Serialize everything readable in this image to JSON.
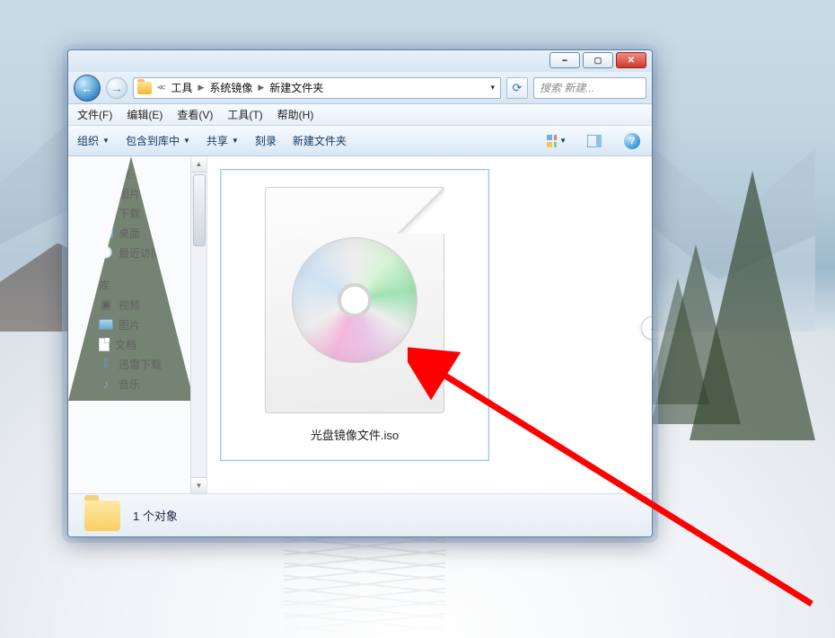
{
  "breadcrumb": {
    "seg1": "工具",
    "seg2": "系统镜像",
    "seg3": "新建文件夹"
  },
  "search": {
    "placeholder": "搜索 新建..."
  },
  "menubar": {
    "file": "文件(F)",
    "edit": "编辑(E)",
    "view": "查看(V)",
    "tools": "工具(T)",
    "help": "帮助(H)"
  },
  "toolbar": {
    "organize": "组织",
    "include": "包含到库中",
    "share": "共享",
    "burn": "刻录",
    "newfolder": "新建文件夹"
  },
  "sidebar": {
    "favorites": "收藏夹",
    "fav_items": {
      "pictures": "图片",
      "downloads": "下载",
      "desktop": "桌面",
      "recent": "最近访问的位置"
    },
    "library": "库",
    "lib_items": {
      "videos": "视频",
      "pictures": "图片",
      "documents": "文档",
      "xunlei": "迅雷下载",
      "music": "音乐"
    }
  },
  "content": {
    "file_label": "光盘镜像文件.iso"
  },
  "status": {
    "text": "1 个对象"
  }
}
